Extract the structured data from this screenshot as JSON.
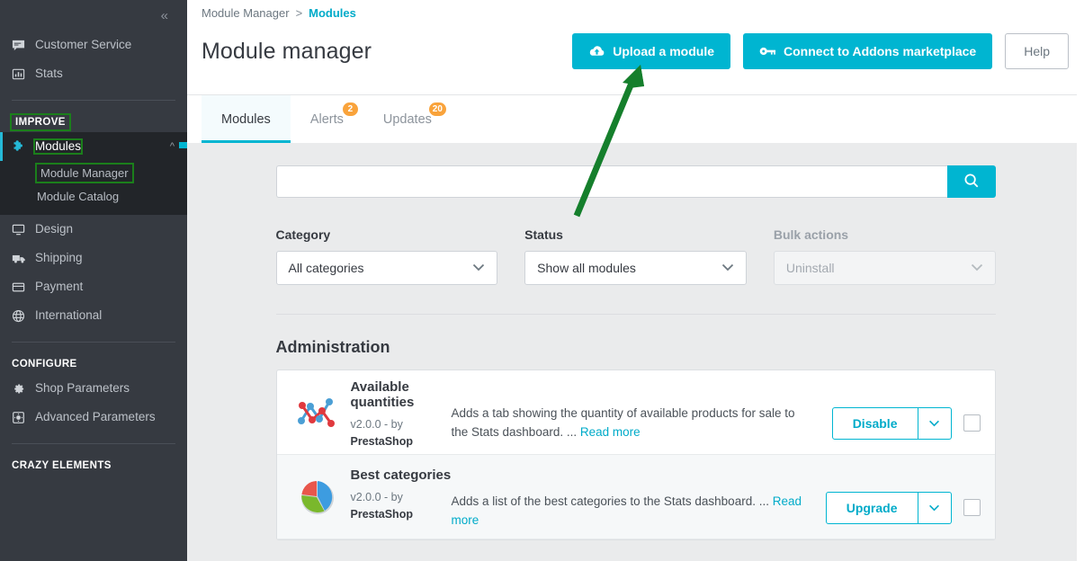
{
  "sidebar": {
    "collapse_icon": "chevron-double-left-icon",
    "items": [
      {
        "label": "Customer Service",
        "icon": "comment-icon"
      },
      {
        "label": "Stats",
        "icon": "bar-chart-icon"
      }
    ],
    "improve_title": "IMPROVE",
    "modules_item": {
      "label": "Modules",
      "icon": "puzzle-piece-icon",
      "expand_icon": "chevron-up-icon"
    },
    "submenu": [
      {
        "label": "Module Manager",
        "highlighted": true
      },
      {
        "label": "Module Catalog",
        "highlighted": false
      }
    ],
    "improve_items": [
      {
        "label": "Design",
        "icon": "monitor-icon"
      },
      {
        "label": "Shipping",
        "icon": "truck-icon"
      },
      {
        "label": "Payment",
        "icon": "credit-card-icon"
      },
      {
        "label": "International",
        "icon": "globe-icon"
      }
    ],
    "configure_title": "CONFIGURE",
    "configure_items": [
      {
        "label": "Shop Parameters",
        "icon": "gear-icon"
      },
      {
        "label": "Advanced Parameters",
        "icon": "sliders-icon"
      }
    ],
    "crazy_title": "CRAZY ELEMENTS"
  },
  "header": {
    "breadcrumb_root": "Module Manager",
    "breadcrumb_sep": ">",
    "breadcrumb_current": "Modules",
    "title": "Module manager",
    "upload_button": "Upload a module",
    "upload_icon": "cloud-upload-icon",
    "connect_button": "Connect to Addons marketplace",
    "connect_icon": "key-icon",
    "help_button": "Help"
  },
  "tabs": [
    {
      "label": "Modules",
      "badge": "",
      "active": true
    },
    {
      "label": "Alerts",
      "badge": "2",
      "active": false
    },
    {
      "label": "Updates",
      "badge": "20",
      "active": false
    }
  ],
  "search": {
    "value": "",
    "placeholder": "",
    "button_icon": "search-icon"
  },
  "filters": {
    "category": {
      "label": "Category",
      "value": "All categories"
    },
    "status": {
      "label": "Status",
      "value": "Show all modules"
    },
    "bulk": {
      "label": "Bulk actions",
      "value": "Uninstall",
      "disabled": true
    }
  },
  "section": {
    "title": "Administration"
  },
  "modules": [
    {
      "name": "Available quantities",
      "icon": "line-chart-icon",
      "version": "v2.0.0 - by",
      "author": "PrestaShop",
      "description": "Adds a tab showing the quantity of available products for sale to the Stats dashboard. ...",
      "read_more": "Read more",
      "action": "Disable",
      "caret_icon": "chevron-down-icon"
    },
    {
      "name": "Best categories",
      "icon": "pie-chart-icon",
      "version": "v2.0.0 - by",
      "author": "PrestaShop",
      "description": "Adds a list of the best categories to the Stats dashboard. ...",
      "read_more": "Read more",
      "action": "Upgrade",
      "caret_icon": "chevron-down-icon"
    }
  ],
  "annotation": {
    "arrow_color": "#157f2c",
    "highlight_color": "#1b7f1b",
    "points_to": "Upload a module"
  },
  "colors": {
    "accent": "#00b5d1",
    "sidebar_bg": "#363a41",
    "badge": "#f9a33b",
    "link": "#00abc9"
  }
}
